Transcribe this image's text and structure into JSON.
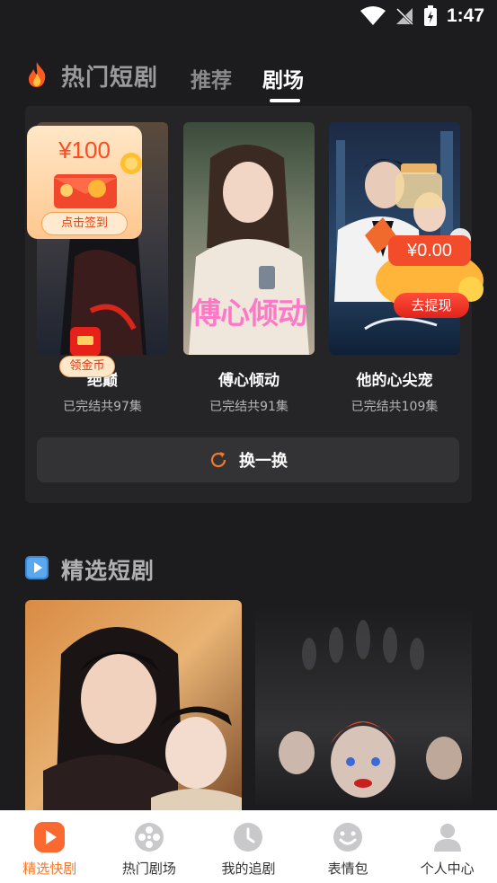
{
  "status_bar": {
    "time": "1:47"
  },
  "hot_section": {
    "title": "热门短剧",
    "tabs": [
      {
        "label": "推荐",
        "active": false
      },
      {
        "label": "剧场",
        "active": true
      }
    ],
    "dramas": [
      {
        "title": "绝巅",
        "subtitle": "已完结共97集"
      },
      {
        "title": "傅心倾动",
        "subtitle": "已完结共91集",
        "poster_text": "傅心倾动"
      },
      {
        "title": "他的心尖宠",
        "subtitle": "已完结共109集"
      }
    ],
    "refresh_label": "换一换"
  },
  "overlays": {
    "signin_amount": "¥100",
    "signin_button": "点击签到",
    "coin_label": "领金币",
    "cash_amount": "¥0.00",
    "withdraw_button": "去提现"
  },
  "selected_section": {
    "title": "精选短剧"
  },
  "bottom_nav": [
    {
      "label": "精选快剧",
      "icon": "play-icon",
      "active": true
    },
    {
      "label": "热门剧场",
      "icon": "film-reel-icon",
      "active": false
    },
    {
      "label": "我的追剧",
      "icon": "clock-icon",
      "active": false
    },
    {
      "label": "表情包",
      "icon": "smiley-icon",
      "active": false
    },
    {
      "label": "个人中心",
      "icon": "person-icon",
      "active": false
    }
  ],
  "colors": {
    "accent": "#f2782a",
    "background": "#1c1c1e",
    "panel": "#252527"
  }
}
